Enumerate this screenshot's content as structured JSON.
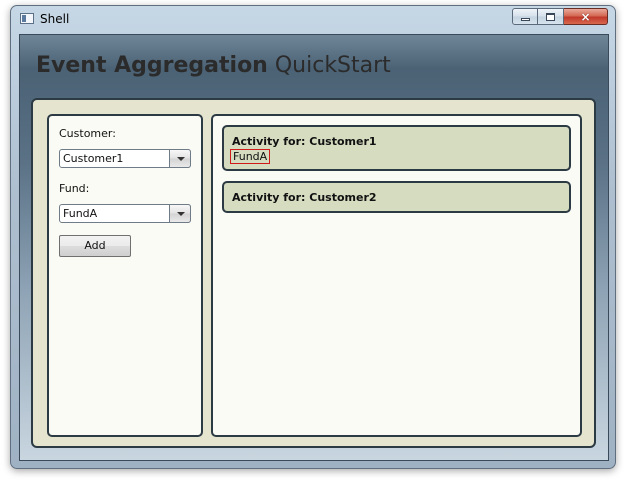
{
  "window": {
    "title": "Shell",
    "buttons": {
      "minimize": "minimize",
      "maximize": "maximize",
      "close": "×"
    }
  },
  "app": {
    "title_bold": "Event Aggregation",
    "title_light": " QuickStart"
  },
  "form": {
    "customer_label": "Customer:",
    "customer_value": "Customer1",
    "fund_label": "Fund:",
    "fund_value": "FundA",
    "add_label": "Add"
  },
  "activity": [
    {
      "header": "Activity for: Customer1",
      "funds": [
        "FundA"
      ]
    },
    {
      "header": "Activity for: Customer2",
      "funds": []
    }
  ],
  "colors": {
    "frame_fill": "#e4e4cf",
    "panel_fill": "#fbfbf5",
    "activity_fill": "#d5dcc0",
    "highlight_border": "#d11a1a"
  }
}
